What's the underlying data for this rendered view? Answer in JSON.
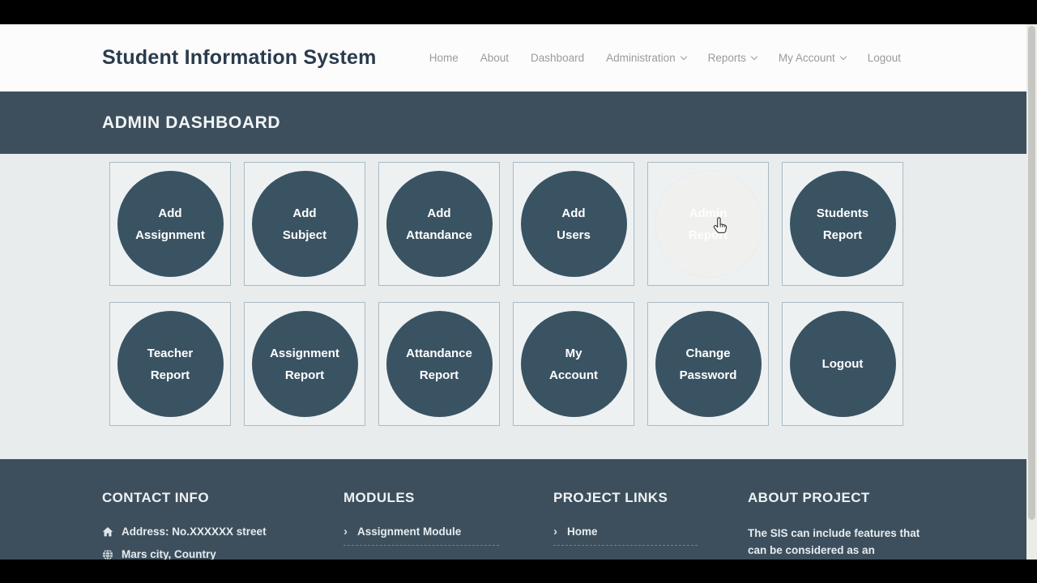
{
  "header": {
    "brand": "Student Information System",
    "nav": [
      {
        "label": "Home",
        "has_dropdown": false
      },
      {
        "label": "About",
        "has_dropdown": false
      },
      {
        "label": "Dashboard",
        "has_dropdown": false
      },
      {
        "label": "Administration",
        "has_dropdown": true
      },
      {
        "label": "Reports",
        "has_dropdown": true
      },
      {
        "label": "My Account",
        "has_dropdown": true
      },
      {
        "label": "Logout",
        "has_dropdown": false
      }
    ]
  },
  "banner": {
    "title": "ADMIN DASHBOARD"
  },
  "tiles": [
    {
      "line1": "Add",
      "line2": "Assignment",
      "state": "normal"
    },
    {
      "line1": "Add",
      "line2": "Subject",
      "state": "normal"
    },
    {
      "line1": "Add",
      "line2": "Attandance",
      "state": "normal"
    },
    {
      "line1": "Add",
      "line2": "Users",
      "state": "normal"
    },
    {
      "line1": "Admin",
      "line2": "Report",
      "state": "hover"
    },
    {
      "line1": "Students",
      "line2": "Report",
      "state": "normal"
    },
    {
      "line1": "Teacher",
      "line2": "Report",
      "state": "normal"
    },
    {
      "line1": "Assignment",
      "line2": "Report",
      "state": "normal"
    },
    {
      "line1": "Attandance",
      "line2": "Report",
      "state": "normal"
    },
    {
      "line1": "My",
      "line2": "Account",
      "state": "normal"
    },
    {
      "line1": "Change",
      "line2": "Password",
      "state": "normal"
    },
    {
      "line1": "Logout",
      "line2": "",
      "state": "normal"
    }
  ],
  "footer": {
    "contact": {
      "heading": "CONTACT INFO",
      "items": [
        {
          "icon": "home-icon",
          "text": "Address: No.XXXXXX street"
        },
        {
          "icon": "globe-icon",
          "text": "Mars city, Country"
        }
      ]
    },
    "modules": {
      "heading": "MODULES",
      "links": [
        {
          "label": "Assignment Module"
        }
      ]
    },
    "project_links": {
      "heading": "PROJECT LINKS",
      "links": [
        {
          "label": "Home"
        }
      ]
    },
    "about": {
      "heading": "ABOUT PROJECT",
      "text": "The SIS can include features that can be considered as an enterprise resource"
    }
  },
  "colors": {
    "accent_dark": "#3d4f5c",
    "circle_fill": "#3a5363",
    "circle_hover_fill": "#f0f0ee",
    "page_bg": "#e8eced",
    "card_bg": "#eef1f2",
    "card_border": "#aabbc4",
    "nav_text": "#9b9b9b",
    "brand_text": "#2a3b4d",
    "footer_text": "#e6ecf0",
    "letterbox": "#000000"
  }
}
